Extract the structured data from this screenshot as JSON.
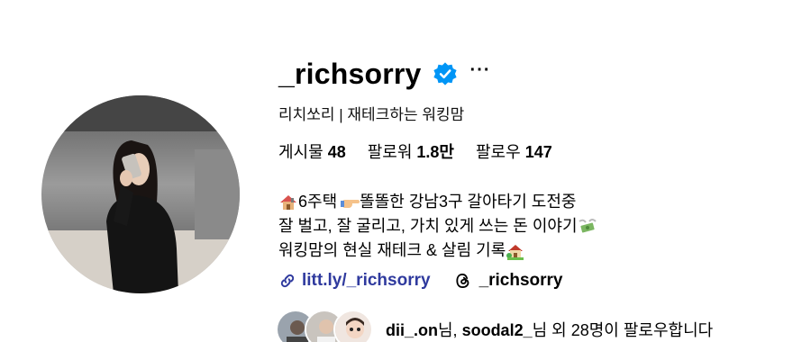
{
  "profile": {
    "username": "_richsorry",
    "full_name": "리치쏘리 | 재테크하는 워킹맘",
    "more_label": "···"
  },
  "stats": [
    {
      "label": "게시물",
      "value": "48"
    },
    {
      "label": "팔로워",
      "value": "1.8만"
    },
    {
      "label": "팔로우",
      "value": "147"
    }
  ],
  "bio": {
    "line1_a": "6주택",
    "line1_b": " 똘똘한 강남3구 갈아타기 도전중",
    "line2": "잘 벌고, 잘 굴리고, 가치 있게 쓰는 돈 이야기 ",
    "line3": "워킹맘의 현실 재테크 & 살림 기록 "
  },
  "links": {
    "website": "litt.ly/_richsorry",
    "threads": "_richsorry"
  },
  "followed_by": {
    "user1": "dii_.on",
    "sep1": "님, ",
    "user2": "soodal2_",
    "suffix": "님 외 28명이 팔로우합니다"
  },
  "icons": {
    "verified": "verified-badge-icon",
    "link": "link-icon",
    "threads": "threads-icon"
  },
  "colors": {
    "verified": "#0095f6",
    "link": "#2f3a9e"
  }
}
